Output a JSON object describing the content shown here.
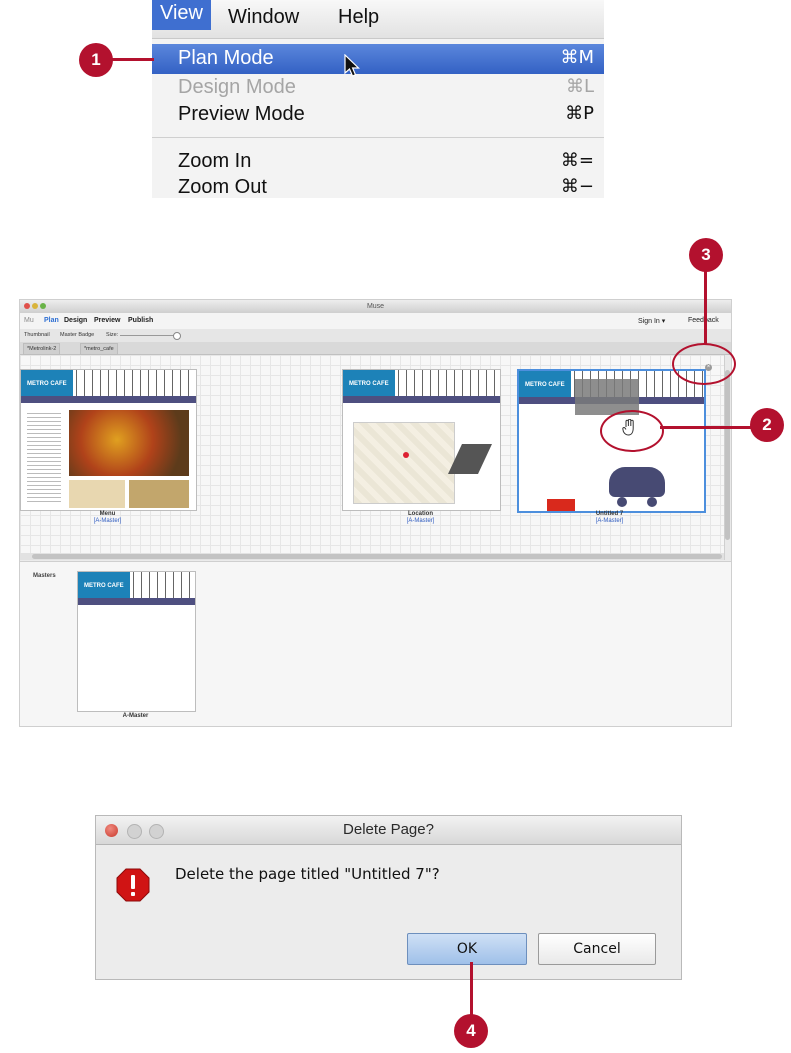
{
  "menu": {
    "bar": [
      "View",
      "Window",
      "Help"
    ],
    "items": [
      {
        "label": "Plan Mode",
        "shortcut": "⌘M",
        "state": "highlighted"
      },
      {
        "label": "Design Mode",
        "shortcut": "⌘L",
        "state": "disabled"
      },
      {
        "label": "Preview Mode",
        "shortcut": "⌘P",
        "state": "normal"
      },
      {
        "label": "Zoom In",
        "shortcut": "⌘=",
        "state": "normal"
      },
      {
        "label": "Zoom Out",
        "shortcut": "⌘−",
        "state": "normal"
      }
    ]
  },
  "callouts": [
    "1",
    "2",
    "3",
    "4"
  ],
  "muse": {
    "title": "Muse",
    "logo": "Mu",
    "modes": [
      "Plan",
      "Design",
      "Preview",
      "Publish"
    ],
    "sign_in": "Sign In ▾",
    "feedback": "Feedback",
    "options": [
      "Thumbnail",
      "Master Badge",
      "Size:"
    ],
    "tabs": [
      "*Metrolink-2",
      "*metro_cafe"
    ],
    "brand": "METRO CAFE",
    "pages": [
      {
        "name": "Menu",
        "master": "[A-Master]"
      },
      {
        "name": "Location",
        "master": "[A-Master]"
      },
      {
        "name": "Untitled 7",
        "master": "[A-Master]"
      }
    ],
    "masters_label": "Masters",
    "master_page": "A-Master"
  },
  "dialog": {
    "title": "Delete Page?",
    "message": "Delete the page titled \"Untitled 7\"?",
    "ok": "OK",
    "cancel": "Cancel"
  },
  "colors": {
    "accent_red": "#b3112e",
    "menu_highlight": "#3f6fd0",
    "brand_blue": "#1d82b8"
  }
}
